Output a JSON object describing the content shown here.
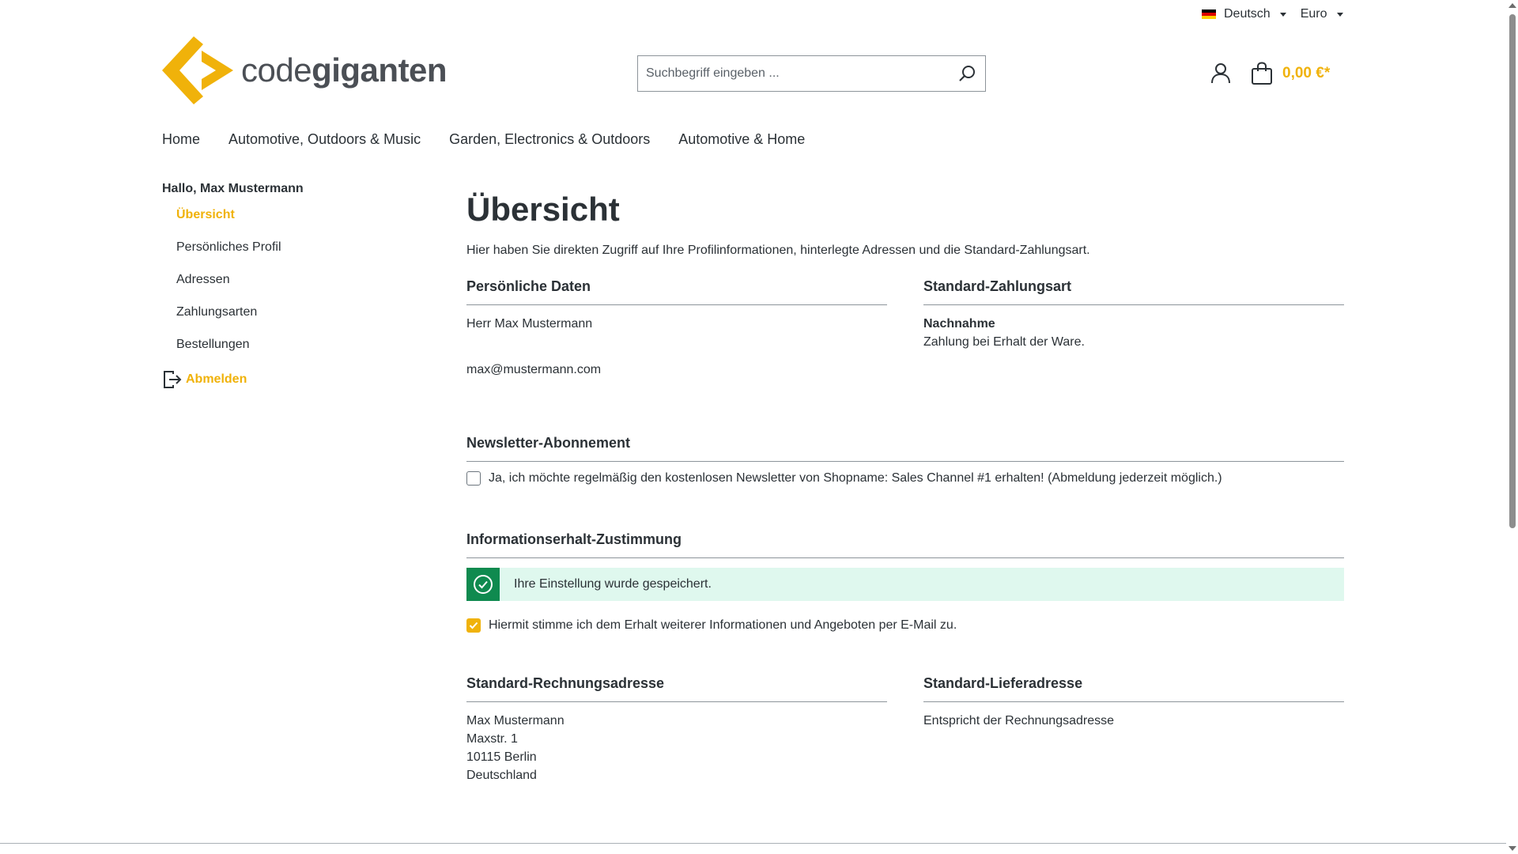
{
  "topbar": {
    "language": "Deutsch",
    "currency": "Euro"
  },
  "header": {
    "logo_light": "code",
    "logo_bold": "giganten",
    "search_placeholder": "Suchbegriff eingeben ...",
    "cart_total": "0,00 €*"
  },
  "nav": {
    "items": [
      {
        "label": "Home"
      },
      {
        "label": "Automotive, Outdoors & Music"
      },
      {
        "label": "Garden, Electronics & Outdoors"
      },
      {
        "label": "Automotive & Home"
      }
    ]
  },
  "sidebar": {
    "greeting": "Hallo, Max Mustermann",
    "items": [
      {
        "label": "Übersicht"
      },
      {
        "label": "Persönliches Profil"
      },
      {
        "label": "Adressen"
      },
      {
        "label": "Zahlungsarten"
      },
      {
        "label": "Bestellungen"
      }
    ],
    "logout": "Abmelden"
  },
  "main": {
    "title": "Übersicht",
    "intro": "Hier haben Sie direkten Zugriff auf Ihre Profilinformationen, hinterlegte Adressen und die Standard-Zahlungsart.",
    "personal": {
      "title": "Persönliche Daten",
      "name": "Herr Max Mustermann",
      "email": "max@mustermann.com"
    },
    "payment": {
      "title": "Standard-Zahlungsart",
      "method": "Nachnahme",
      "description": "Zahlung bei Erhalt der Ware."
    },
    "newsletter": {
      "title": "Newsletter-Abonnement",
      "label": "Ja, ich möchte regelmäßig den kostenlosen Newsletter von Shopname: Sales Channel #1 erhalten! (Abmeldung jederzeit möglich.)",
      "checked": false
    },
    "consent": {
      "title": "Informationserhalt-Zustimmung",
      "alert": "Ihre Einstellung wurde gespeichert.",
      "label": "Hiermit stimme ich dem Erhalt weiterer Informationen und Angeboten per E-Mail zu.",
      "checked": true
    },
    "billing": {
      "title": "Standard-Rechnungsadresse",
      "lines": [
        "Max Mustermann",
        "Maxstr. 1",
        "10115 Berlin",
        "Deutschland"
      ]
    },
    "shipping": {
      "title": "Standard-Lieferadresse",
      "text": "Entspricht der Rechnungsadresse"
    }
  },
  "colors": {
    "accent": "#f0b20a",
    "success": "#0f8a4f",
    "success_bg": "#dff8ee",
    "text": "#2b3136"
  }
}
